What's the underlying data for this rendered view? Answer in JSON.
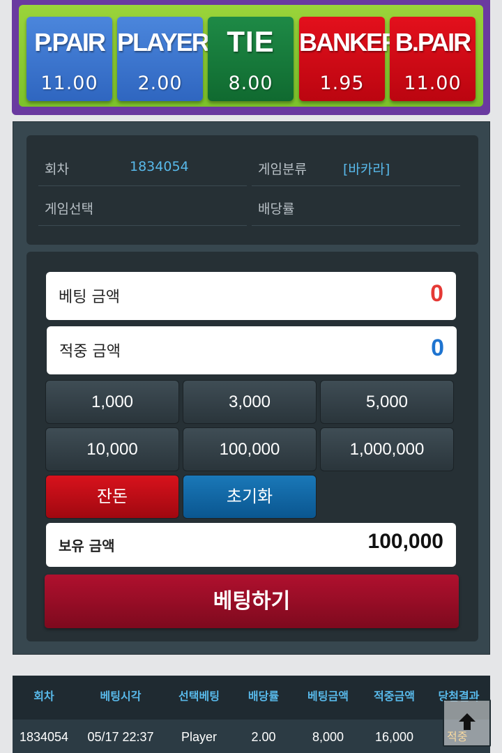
{
  "bet_options": [
    {
      "name": "P.PAIR",
      "odds": "11.00"
    },
    {
      "name": "PLAYER",
      "odds": "2.00"
    },
    {
      "name": "TIE",
      "odds": "8.00"
    },
    {
      "name": "BANKER",
      "odds": "1.95"
    },
    {
      "name": "B.PAIR",
      "odds": "11.00"
    }
  ],
  "info": {
    "round_label": "회차",
    "round_value": "1834054",
    "category_label": "게임분류",
    "category_value": "[바카라]",
    "selection_label": "게임선택",
    "selection_value": "",
    "odds_label": "배당률",
    "odds_value": ""
  },
  "form": {
    "bet_amount_label": "베팅 금액",
    "bet_amount_value": "0",
    "win_amount_label": "적중 금액",
    "win_amount_value": "0",
    "chips": [
      "1,000",
      "3,000",
      "5,000",
      "10,000",
      "100,000",
      "1,000,000"
    ],
    "change_label": "잔돈",
    "reset_label": "초기화",
    "balance_label": "보유 금액",
    "balance_value": "100,000",
    "submit_label": "베팅하기"
  },
  "colors": {
    "bet_amount": "#e53935",
    "win_amount": "#1e74d0"
  },
  "history": {
    "headers": [
      "회차",
      "베팅시각",
      "선택베팅",
      "배당률",
      "베팅금액",
      "적중금액",
      "당첨결과"
    ],
    "rows": [
      [
        "1834054",
        "05/17 22:37",
        "Player",
        "2.00",
        "8,000",
        "16,000",
        "적중"
      ]
    ]
  },
  "scroll_top_icon": "arrow-up-icon"
}
